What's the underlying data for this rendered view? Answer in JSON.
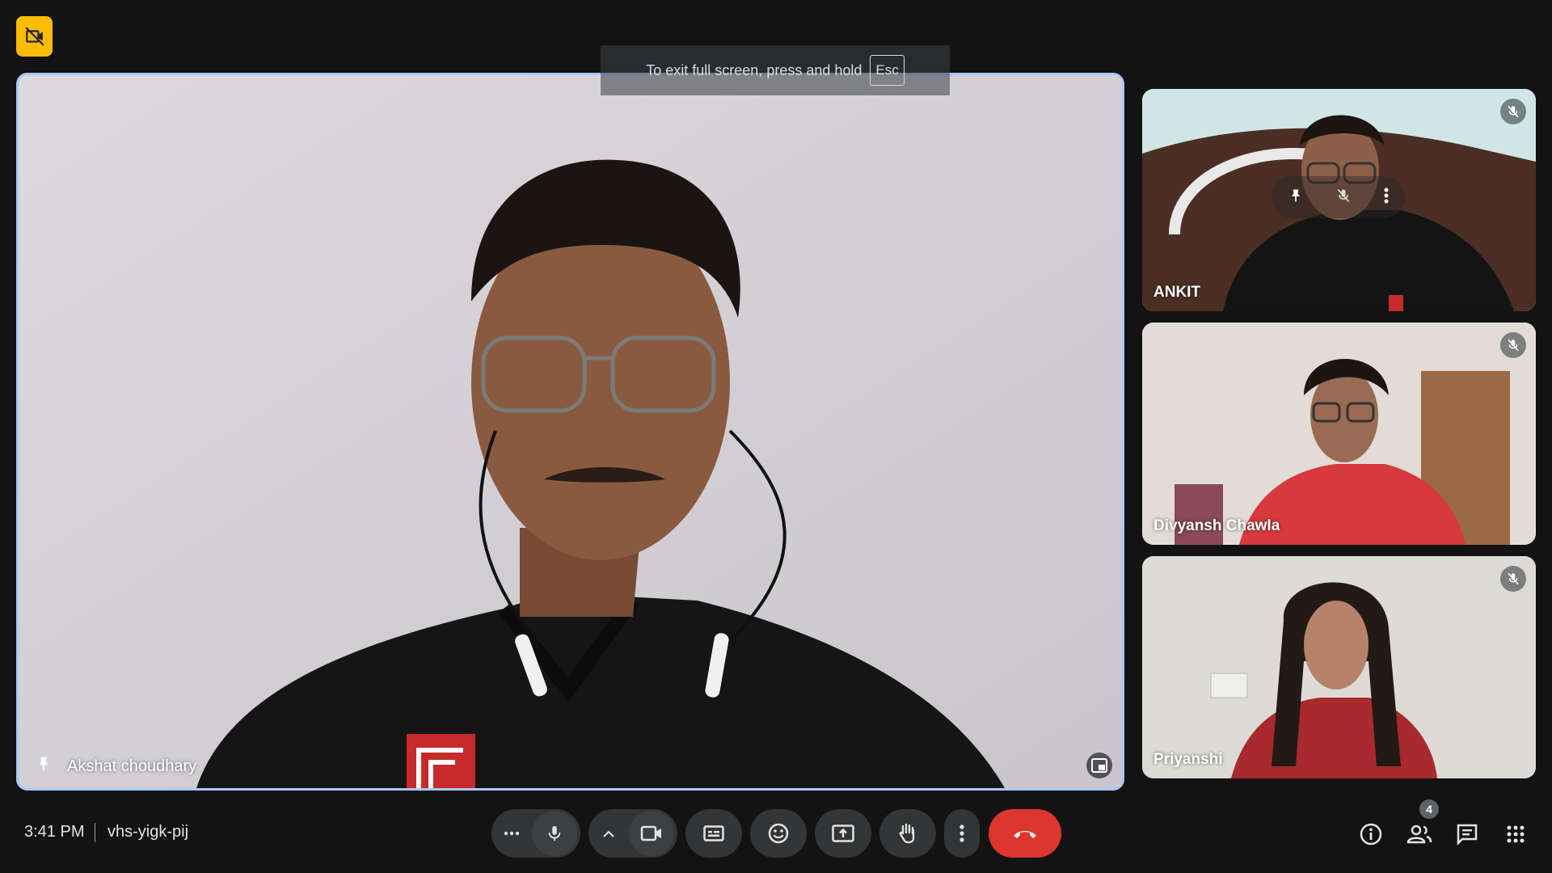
{
  "fullscreen_hint": {
    "text": "To exit full screen, press and hold",
    "key": "Esc"
  },
  "participants": {
    "main": {
      "name": "Akshat choudhary"
    },
    "side": [
      {
        "name": "ANKIT",
        "muted": true
      },
      {
        "name": "Divyansh Chawla",
        "muted": true
      },
      {
        "name": "Priyanshi",
        "muted": true
      }
    ]
  },
  "footer": {
    "time": "3:41 PM",
    "meeting_code": "vhs-yigk-pij",
    "participant_count": "4"
  },
  "icons": {
    "recording": "camera-off-icon",
    "mic": "mic-icon",
    "camera": "videocam-icon",
    "captions": "captions-icon",
    "emoji": "emoji-icon",
    "present": "present-screen-icon",
    "hand": "raise-hand-icon",
    "more": "more-vert-icon",
    "end": "call-end-icon",
    "info": "info-icon",
    "people": "people-icon",
    "chat": "chat-icon",
    "apps": "apps-icon"
  },
  "colors": {
    "background": "#131314",
    "active_border": "#a8c7fa",
    "end_call": "#dc362e",
    "badge": "#fbbc04"
  }
}
